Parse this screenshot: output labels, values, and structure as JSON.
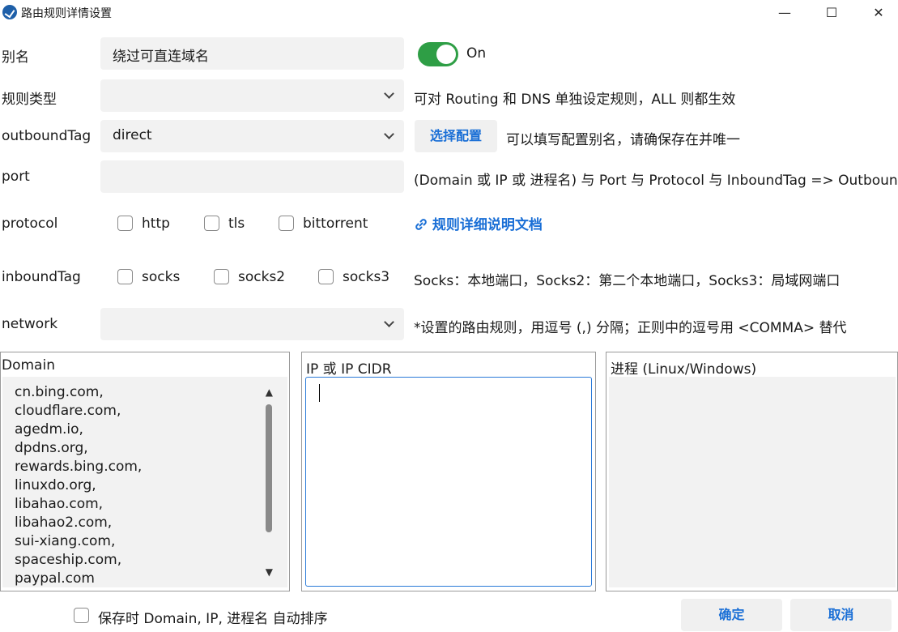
{
  "window": {
    "title": "路由规则详情设置",
    "minimize": "—",
    "maximize": "☐",
    "close": "✕"
  },
  "alias": {
    "label": "别名",
    "value": "绕过可直连域名",
    "toggle_state": "On"
  },
  "rule_type": {
    "label": "规则类型",
    "value": "",
    "hint": "可对 Routing 和 DNS 单独设定规则，ALL 则都生效"
  },
  "outbound": {
    "label": "outboundTag",
    "value": "direct",
    "select_button": "选择配置",
    "hint": "可以填写配置别名，请确保存在并唯一"
  },
  "port": {
    "label": "port",
    "value": "",
    "hint": "(Domain 或 IP 或 进程名) 与 Port 与 Protocol 与 InboundTag => Outbound"
  },
  "protocol": {
    "label": "protocol",
    "options": [
      "http",
      "tls",
      "bittorrent"
    ],
    "doc_link": "规则详细说明文档"
  },
  "inbound": {
    "label": "inboundTag",
    "options": [
      "socks",
      "socks2",
      "socks3"
    ],
    "hint": "Socks：本地端口，Socks2：第二个本地端口，Socks3：局域网端口"
  },
  "network": {
    "label": "network",
    "value": "",
    "hint": "*设置的路由规则，用逗号 (,) 分隔；正则中的逗号用 <COMMA> 替代"
  },
  "domain": {
    "title": "Domain",
    "items": [
      "cn.bing.com,",
      "cloudflare.com,",
      "agedm.io,",
      "dpdns.org,",
      "rewards.bing.com,",
      "linuxdo.org,",
      "libahao.com,",
      "libahao2.com,",
      "sui-xiang.com,",
      "spaceship.com,",
      "paypal.com"
    ]
  },
  "ip": {
    "title": "IP 或 IP CIDR",
    "value": ""
  },
  "process": {
    "title": "进程 (Linux/Windows)",
    "value": ""
  },
  "footer": {
    "sort_label": "保存时 Domain, IP, 进程名 自动排序",
    "ok": "确定",
    "cancel": "取消"
  },
  "colors": {
    "accent": "#1a6fd6",
    "toggle_on": "#2e9e45",
    "field_bg": "#f2f2f2"
  }
}
